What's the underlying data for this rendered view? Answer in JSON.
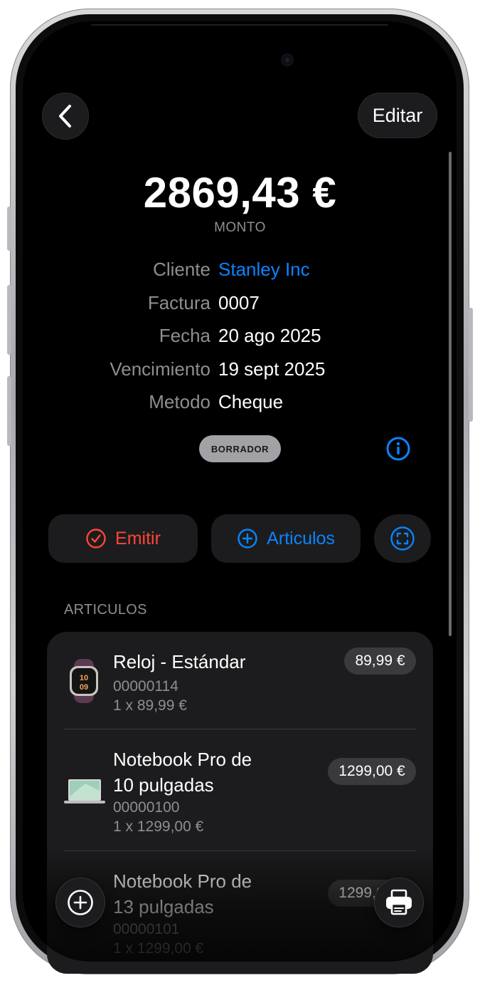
{
  "header": {
    "edit_label": "Editar"
  },
  "invoice": {
    "amount": "2869,43 €",
    "amount_label": "MONTO",
    "fields": [
      {
        "label": "Cliente",
        "value": "Stanley Inc"
      },
      {
        "label": "Factura",
        "value": "0007"
      },
      {
        "label": "Fecha",
        "value": "20 ago 2025"
      },
      {
        "label": "Vencimiento",
        "value": "19 sept 2025"
      },
      {
        "label": "Metodo",
        "value": "Cheque"
      }
    ],
    "status_badge": "BORRADOR"
  },
  "actions": {
    "emit_label": "Emitir",
    "items_label": "Articulos"
  },
  "items_section": {
    "label": "ARTICULOS",
    "items": [
      {
        "title": "Reloj - Estándar",
        "sku": "00000114",
        "qty_line": "1 x 89,99 €",
        "price": "89,99 €"
      },
      {
        "title_line1": "Notebook Pro de",
        "title_line2": "10 pulgadas",
        "sku": "00000100",
        "qty_line": "1 x 1299,00 €",
        "price": "1299,00 €"
      },
      {
        "title_line1": "Notebook Pro de",
        "title_line2": "13 pulgadas",
        "sku": "00000101",
        "qty_line": "1 x 1299,00 €",
        "price": "1299,00 €"
      }
    ]
  },
  "colors": {
    "accent": "#0a84ff",
    "danger": "#ff453a",
    "background": "#000000",
    "card": "#1c1c1e"
  },
  "icons": {
    "back": "chevron-left-icon",
    "info": "info-icon",
    "emit": "checkmark-circle-icon",
    "add_items": "plus-circle-icon",
    "scan": "scan-frame-icon",
    "fab_add": "plus-circle-icon",
    "print": "printer-icon"
  }
}
